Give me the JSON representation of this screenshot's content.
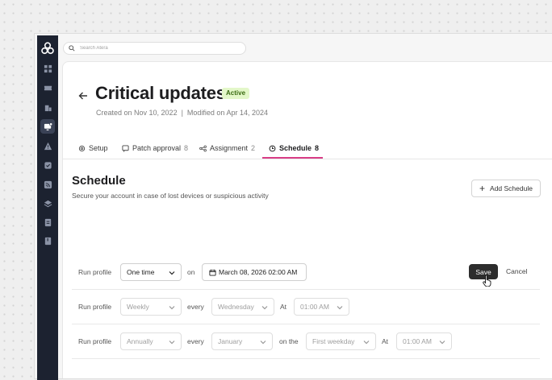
{
  "search": {
    "placeholder": "Search Atera"
  },
  "page": {
    "title": "Critical updates",
    "status_badge": "Active",
    "meta": "Created on Nov 10, 2022  |  Modified on Apr 14, 2024"
  },
  "tabs": [
    {
      "label": "Setup",
      "count": "",
      "icon": "settings-icon"
    },
    {
      "label": "Patch approval",
      "count": "8",
      "icon": "patch-approval-icon"
    },
    {
      "label": "Assignment",
      "count": "2",
      "icon": "assignment-icon"
    },
    {
      "label": "Schedule",
      "count": "8",
      "icon": "schedule-icon",
      "active": true
    }
  ],
  "schedule": {
    "title": "Schedule",
    "subtitle": "Secure your account in case of lost devices or suspicious activity",
    "add_button": "Add Schedule",
    "rows": [
      {
        "label": "Run profile",
        "frequency": "One time",
        "on_label": "on",
        "date": "March 08, 2026 02:00 AM",
        "save": "Save",
        "cancel": "Cancel"
      },
      {
        "label": "Run profile",
        "frequency": "Weekly",
        "every_label": "every",
        "day": "Wednesday",
        "at_label": "At",
        "time": "01:00 AM"
      },
      {
        "label": "Run profile",
        "frequency": "Annually",
        "every_label": "every",
        "month": "January",
        "on_the_label": "on the",
        "weekday": "First weekday",
        "at_label": "At",
        "time": "01:00 AM"
      }
    ]
  },
  "colors": {
    "sidebar": "#1c2230",
    "active_tab_underline": "#d93d86",
    "badge_bg": "#e3f7c9",
    "badge_text": "#3a6b12",
    "save_bg": "#2d2d2d"
  }
}
